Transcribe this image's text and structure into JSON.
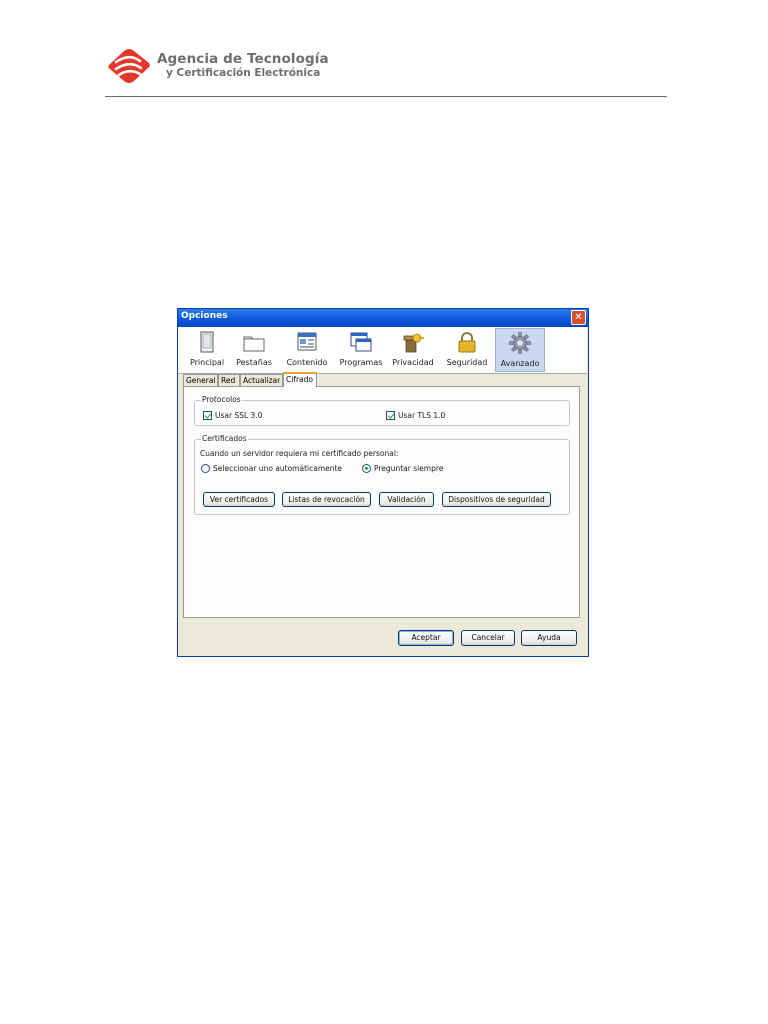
{
  "header": {
    "brand_line1": "Agencia de Tecnología",
    "brand_line2": "y Certificación Electrónica",
    "logo_icon": "atce-logo-icon",
    "accent_color": "#e2382b"
  },
  "window": {
    "title": "Opciones",
    "close_label": "✕",
    "toolbar": [
      {
        "label": "Principal",
        "icon": "principal-icon"
      },
      {
        "label": "Pestañas",
        "icon": "tabs-icon"
      },
      {
        "label": "Contenido",
        "icon": "content-icon"
      },
      {
        "label": "Programas",
        "icon": "programs-icon"
      },
      {
        "label": "Privacidad",
        "icon": "privacy-icon"
      },
      {
        "label": "Seguridad",
        "icon": "lock-icon"
      },
      {
        "label": "Avanzado",
        "icon": "gear-icon",
        "selected": true
      }
    ],
    "tabs": [
      {
        "label": "General"
      },
      {
        "label": "Red"
      },
      {
        "label": "Actualizar"
      },
      {
        "label": "Cifrado",
        "active": true
      }
    ],
    "protocolos": {
      "legend": "Protocolos",
      "ssl_label": "Usar SSL 3.0",
      "ssl_checked": true,
      "tls_label": "Usar TLS 1.0",
      "tls_checked": true
    },
    "certificados": {
      "legend": "Certificados",
      "prompt": "Cuando un servidor requiera mi certificado personal:",
      "option_auto": "Seleccionar uno automáticamente",
      "option_ask": "Preguntar siempre",
      "selected_option": "Preguntar siempre",
      "buttons": {
        "ver": "Ver certificados",
        "listas": "Listas de revocación",
        "validacion": "Validación",
        "dispositivos": "Dispositivos de seguridad"
      }
    },
    "footer": {
      "aceptar": "Aceptar",
      "cancelar": "Cancelar",
      "ayuda": "Ayuda"
    }
  }
}
